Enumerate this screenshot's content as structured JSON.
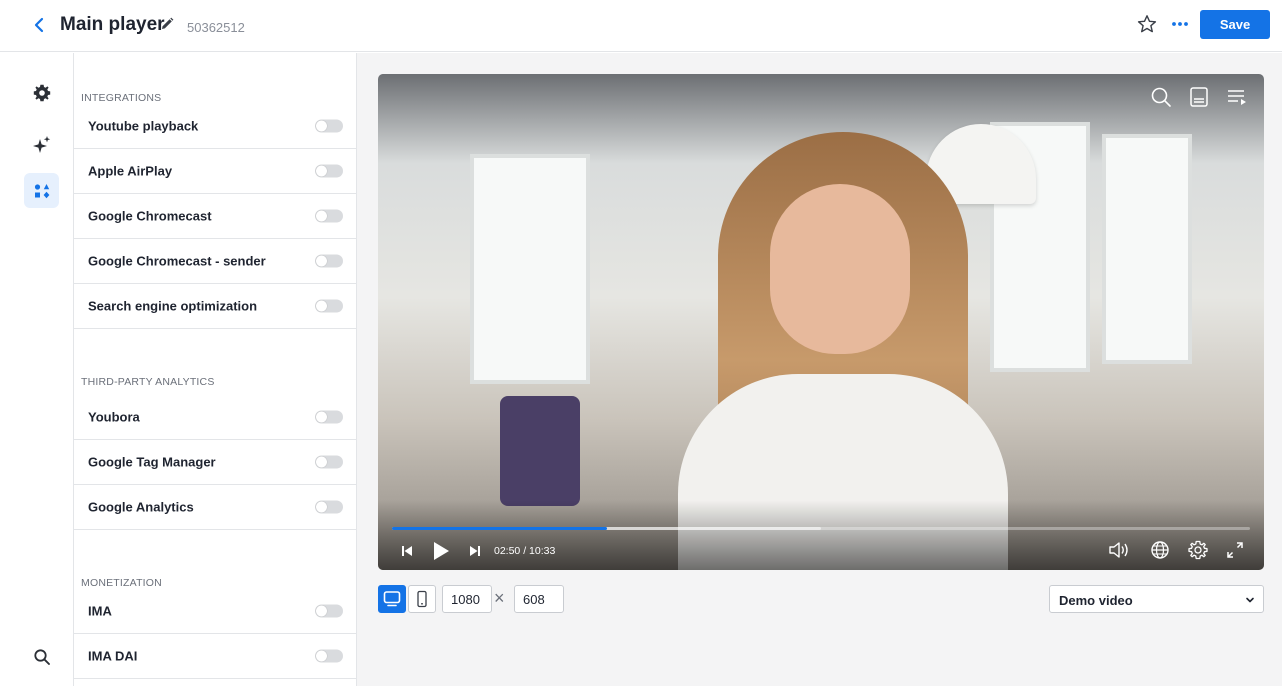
{
  "header": {
    "title": "Main player",
    "player_id": "50362512",
    "save_label": "Save"
  },
  "icons": {
    "back": "chevron-left-icon",
    "edit": "pencil-icon",
    "favorite": "star-icon",
    "more": "more-dots-icon",
    "rail": [
      "gear-icon",
      "sparkles-icon",
      "shapes-icon",
      "search-icon"
    ]
  },
  "panel": {
    "sections": [
      {
        "title": "INTEGRATIONS",
        "items": [
          {
            "label": "Youtube playback",
            "enabled": false
          },
          {
            "label": "Apple AirPlay",
            "enabled": false
          },
          {
            "label": "Google Chromecast",
            "enabled": false
          },
          {
            "label": "Google Chromecast - sender",
            "enabled": false
          },
          {
            "label": "Search engine optimization",
            "enabled": false
          }
        ]
      },
      {
        "title": "THIRD-PARTY ANALYTICS",
        "items": [
          {
            "label": "Youbora",
            "enabled": false
          },
          {
            "label": "Google Tag Manager",
            "enabled": false
          },
          {
            "label": "Google Analytics",
            "enabled": false
          }
        ]
      },
      {
        "title": "MONETIZATION",
        "items": [
          {
            "label": "IMA",
            "enabled": false
          },
          {
            "label": "IMA DAI",
            "enabled": false
          }
        ]
      }
    ]
  },
  "player": {
    "time": "02:50 / 10:33",
    "played_fraction": 0.25,
    "buffered_fraction": 0.5
  },
  "toolbar": {
    "width": "1080",
    "height": "608",
    "times": "×",
    "video_select": "Demo video"
  },
  "colors": {
    "accent": "#1473e6",
    "toggle_off": "#d9dbde"
  }
}
